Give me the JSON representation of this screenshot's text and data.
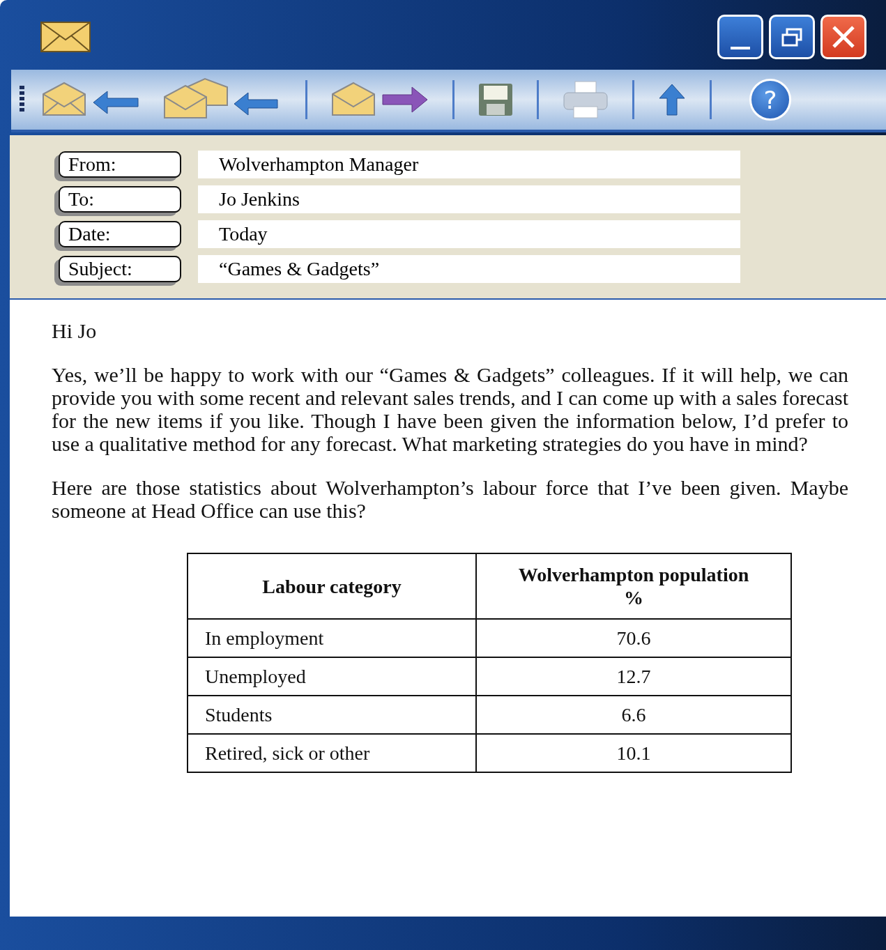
{
  "toolbar": {
    "help": "?"
  },
  "header_fields": [
    {
      "label": "From:",
      "value": "Wolverhampton Manager"
    },
    {
      "label": "To:",
      "value": "Jo Jenkins"
    },
    {
      "label": "Date:",
      "value": "Today"
    },
    {
      "label": "Subject:",
      "value": "“Games & Gadgets”"
    }
  ],
  "body": {
    "greeting": "Hi Jo",
    "paragraphs": [
      "Yes, we’ll be happy to work with our “Games & Gadgets” colleagues. If it will help, we can provide you with some recent and relevant sales trends, and I can come up with a sales forecast for the new items if you like. Though I have been given the information below, I’d prefer to use a qualitative method for any forecast. What marketing strategies do you have in mind?",
      "Here are those statistics about Wolverhampton’s labour force that I’ve been given. Maybe someone at Head Office can use this?"
    ]
  },
  "table": {
    "columns": [
      "Labour category",
      "Wolverhampton population %"
    ],
    "rows": [
      [
        "In employment",
        "70.6"
      ],
      [
        "Unemployed",
        "12.7"
      ],
      [
        "Students",
        "6.6"
      ],
      [
        "Retired, sick or other",
        "10.1"
      ]
    ]
  }
}
